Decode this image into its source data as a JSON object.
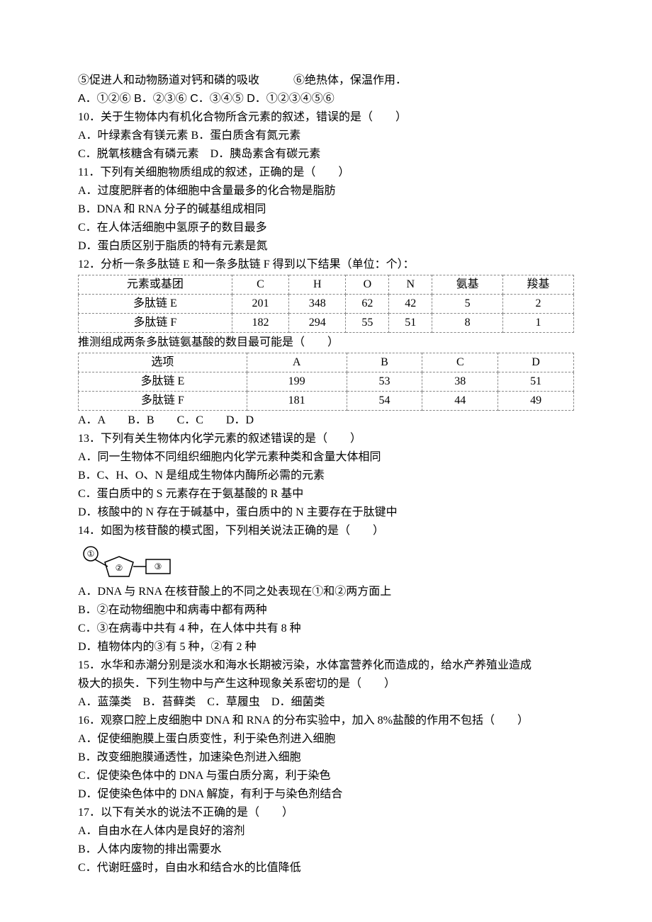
{
  "q9": {
    "opt5": "⑤促进人和动物肠道对钙和磷的吸收",
    "opt6": "⑥绝热体，保温作用．",
    "choices": "A．①②⑥ B．②③⑥ C．③④⑤ D．①②③④⑤⑥"
  },
  "q10": {
    "stem": "10．关于生物体内有机化合物所含元素的叙述，错误的是（　　）",
    "a": "A．叶绿素含有镁元素 B．蛋白质含有氮元素",
    "c": "C．脱氧核糖含有磷元素　D．胰岛素含有碳元素"
  },
  "q11": {
    "stem": "11．下列有关细胞物质组成的叙述，正确的是（　　）",
    "a": "A．过度肥胖者的体细胞中含量最多的化合物是脂肪",
    "b": "B．DNA 和 RNA 分子的碱基组成相同",
    "c": "C．在人体活细胞中氢原子的数目最多",
    "d": "D．蛋白质区别于脂质的特有元素是氮"
  },
  "q12": {
    "stem": "12．分析一条多肽链 E 和一条多肽链 F 得到以下结果（单位：个）：",
    "table1": {
      "headers": [
        "元素或基团",
        "C",
        "H",
        "O",
        "N",
        "氨基",
        "羧基"
      ],
      "rows": [
        [
          "多肽链 E",
          "201",
          "348",
          "62",
          "42",
          "5",
          "2"
        ],
        [
          "多肽链 F",
          "182",
          "294",
          "55",
          "51",
          "8",
          "1"
        ]
      ]
    },
    "mid": "推测组成两条多肽链氨基酸的数目最可能是（　　）",
    "table2": {
      "headers": [
        "选项",
        "A",
        "B",
        "C",
        "D"
      ],
      "rows": [
        [
          "多肽链 E",
          "199",
          "53",
          "38",
          "51"
        ],
        [
          "多肽链 F",
          "181",
          "54",
          "44",
          "49"
        ]
      ]
    },
    "choices": "A．A　　B．B　　C．C　　D．D"
  },
  "q13": {
    "stem": "13．下列有关生物体内化学元素的叙述错误的是（　　）",
    "a": "A．同一生物体不同组织细胞内化学元素种类和含量大体相同",
    "b": "B．C、H、O、N 是组成生物体内酶所必需的元素",
    "c": "C．蛋白质中的 S 元素存在于氨基酸的 R 基中",
    "d": "D．核酸中的 N 存在于碱基中，蛋白质中的 N 主要存在于肽键中"
  },
  "q14": {
    "stem": "14．如图为核苷酸的模式图，下列相关说法正确的是（　　）",
    "labels": {
      "l1": "①",
      "l2": "②",
      "l3": "③"
    },
    "a": "A．DNA 与 RNA 在核苷酸上的不同之处表现在①和②两方面上",
    "b": "B．②在动物细胞中和病毒中都有两种",
    "c": "C．③在病毒中共有 4 种，在人体中共有 8 种",
    "d": "D．植物体内的③有 5 种，②有 2 种"
  },
  "q15": {
    "stem1": "15．水华和赤潮分别是淡水和海水长期被污染，水体富营养化而造成的，给水产养殖业造成",
    "stem2": "极大的损失．下列生物中与产生这种现象关系密切的是（　　）",
    "choices": "A．蓝藻类　B．苔藓类　C．草履虫　D．细菌类"
  },
  "q16": {
    "stem": "16．观察口腔上皮细胞中 DNA 和 RNA 的分布实验中，加入 8%盐酸的作用不包括（　　）",
    "a": "A．促使细胞膜上蛋白质变性，利于染色剂进入细胞",
    "b": "B．改变细胞膜通透性，加速染色剂进入细胞",
    "c": "C．促使染色体中的 DNA 与蛋白质分离，利于染色",
    "d": "D．促使染色体中的 DNA 解旋，有利于与染色剂结合"
  },
  "q17": {
    "stem": "17．以下有关水的说法不正确的是（　　）",
    "a": "A．自由水在人体内是良好的溶剂",
    "b": "B．人体内废物的排出需要水",
    "c": "C．代谢旺盛时，自由水和结合水的比值降低"
  }
}
